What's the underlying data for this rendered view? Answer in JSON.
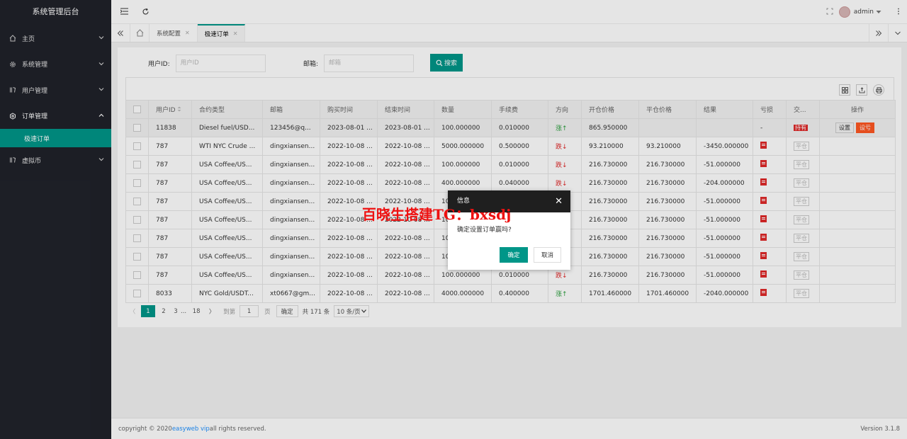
{
  "sidebar": {
    "title": "系统管理后台",
    "items": [
      {
        "label": "主页",
        "icon": "home-icon",
        "expanded": false
      },
      {
        "label": "系统管理",
        "icon": "gear-icon",
        "expanded": false
      },
      {
        "label": "用户管理",
        "icon": "book-icon",
        "expanded": false
      },
      {
        "label": "订单管理",
        "icon": "settings-icon",
        "expanded": true
      },
      {
        "label": "虚拟币",
        "icon": "book-icon",
        "expanded": false
      }
    ],
    "sub_item": "极速订单"
  },
  "header": {
    "user": "admin"
  },
  "tabs": [
    {
      "label": "系统配置"
    },
    {
      "label": "极速订单"
    }
  ],
  "search": {
    "uid_label": "用户ID:",
    "uid_placeholder": "用户ID",
    "email_label": "邮箱:",
    "email_placeholder": "邮箱",
    "button": "搜索"
  },
  "table": {
    "headers": [
      "用户ID",
      "合约类型",
      "邮箱",
      "购买时间",
      "结束时间",
      "数量",
      "手续费",
      "方向",
      "开仓价格",
      "平仓价格",
      "结果",
      "亏损",
      "交...",
      "操作"
    ],
    "rows": [
      {
        "uid": "11838",
        "type": "Diesel fuel/USD...",
        "email": "123456@q...",
        "buy": "2023-08-01 ...",
        "end": "2023-08-01 ...",
        "qty": "100.000000",
        "fee": "0.010000",
        "dir": "涨↑",
        "dir_up": true,
        "open": "865.950000",
        "close": "",
        "result": "",
        "loss": "-",
        "status": "持有",
        "active": true
      },
      {
        "uid": "787",
        "type": "WTI NYC Crude ...",
        "email": "dingxiansen...",
        "buy": "2022-10-08 ...",
        "end": "2022-10-08 ...",
        "qty": "5000.000000",
        "fee": "0.500000",
        "dir": "跌↓",
        "dir_up": false,
        "open": "93.210000",
        "close": "93.210000",
        "result": "-3450.000000",
        "loss": "",
        "status": "平仓",
        "active": false
      },
      {
        "uid": "787",
        "type": "USA Coffee/US...",
        "email": "dingxiansen...",
        "buy": "2022-10-08 ...",
        "end": "2022-10-08 ...",
        "qty": "100.000000",
        "fee": "0.010000",
        "dir": "跌↓",
        "dir_up": false,
        "open": "216.730000",
        "close": "216.730000",
        "result": "-51.000000",
        "loss": "",
        "status": "平仓",
        "active": false
      },
      {
        "uid": "787",
        "type": "USA Coffee/US...",
        "email": "dingxiansen...",
        "buy": "2022-10-08 ...",
        "end": "2022-10-08 ...",
        "qty": "400.000000",
        "fee": "0.040000",
        "dir": "跌↓",
        "dir_up": false,
        "open": "216.730000",
        "close": "216.730000",
        "result": "-204.000000",
        "loss": "",
        "status": "平仓",
        "active": false
      },
      {
        "uid": "787",
        "type": "USA Coffee/US...",
        "email": "dingxiansen...",
        "buy": "2022-10-08 ...",
        "end": "2022-10-08 ...",
        "qty": "10",
        "fee": "",
        "dir": "",
        "dir_up": false,
        "open": "216.730000",
        "close": "216.730000",
        "result": "-51.000000",
        "loss": "",
        "status": "平仓",
        "active": false
      },
      {
        "uid": "787",
        "type": "USA Coffee/US...",
        "email": "dingxiansen...",
        "buy": "2022-10-08 ...",
        "end": "2022-10-08 ...",
        "qty": "10",
        "fee": "",
        "dir": "",
        "dir_up": false,
        "open": "216.730000",
        "close": "216.730000",
        "result": "-51.000000",
        "loss": "",
        "status": "平仓",
        "active": false
      },
      {
        "uid": "787",
        "type": "USA Coffee/US...",
        "email": "dingxiansen...",
        "buy": "2022-10-08 ...",
        "end": "2022-10-08 ...",
        "qty": "10",
        "fee": "",
        "dir": "",
        "dir_up": false,
        "open": "216.730000",
        "close": "216.730000",
        "result": "-51.000000",
        "loss": "",
        "status": "平仓",
        "active": false
      },
      {
        "uid": "787",
        "type": "USA Coffee/US...",
        "email": "dingxiansen...",
        "buy": "2022-10-08 ...",
        "end": "2022-10-08 ...",
        "qty": "10",
        "fee": "",
        "dir": "",
        "dir_up": false,
        "open": "216.730000",
        "close": "216.730000",
        "result": "-51.000000",
        "loss": "",
        "status": "平仓",
        "active": false
      },
      {
        "uid": "787",
        "type": "USA Coffee/US...",
        "email": "dingxiansen...",
        "buy": "2022-10-08 ...",
        "end": "2022-10-08 ...",
        "qty": "100.000000",
        "fee": "0.010000",
        "dir": "跌↓",
        "dir_up": false,
        "open": "216.730000",
        "close": "216.730000",
        "result": "-51.000000",
        "loss": "",
        "status": "平仓",
        "active": false
      },
      {
        "uid": "8033",
        "type": "NYC Gold/USDT...",
        "email": "xt0667@gm...",
        "buy": "2022-10-08 ...",
        "end": "2022-10-08 ...",
        "qty": "4000.000000",
        "fee": "0.400000",
        "dir": "涨↑",
        "dir_up": true,
        "open": "1701.460000",
        "close": "1701.460000",
        "result": "-2040.000000",
        "loss": "",
        "status": "平仓",
        "active": false
      }
    ],
    "op_set": "设置",
    "op_edit": "设亏"
  },
  "pager": {
    "pages": [
      "1",
      "2",
      "3"
    ],
    "ellipsis": "...",
    "last": "18",
    "goto_label": "到第",
    "goto_value": "1",
    "page_unit": "页",
    "confirm": "确定",
    "total": "共 171 条",
    "per_page": "10 条/页"
  },
  "dialog": {
    "title": "信息",
    "message": "确定设置订单赢吗?",
    "ok": "确定",
    "cancel": "取消"
  },
  "watermark": "百晓生搭建TG：bxsdj",
  "footer": {
    "copyright_pre": "copyright © 2020 ",
    "link": "easyweb vip",
    "copyright_post": " all rights reserved.",
    "version": "Version 3.1.8"
  },
  "colors": {
    "accent": "#009688",
    "sidebar": "#20222a",
    "danger": "#e02a2a",
    "up": "#2a9d3c"
  }
}
